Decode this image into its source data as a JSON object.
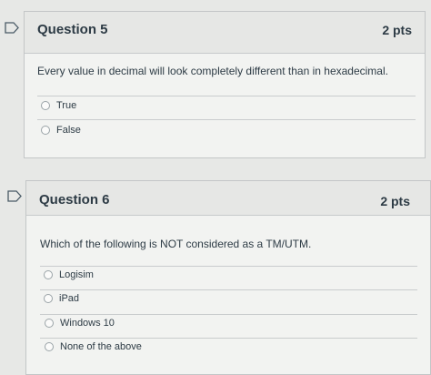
{
  "questions": [
    {
      "title": "Question 5",
      "points": "2 pts",
      "text": "Every value in decimal will look completely different than in hexadecimal.",
      "answers": [
        {
          "label": "True"
        },
        {
          "label": "False"
        }
      ]
    },
    {
      "title": "Question 6",
      "points": "2 pts",
      "text": "Which of the following is NOT considered as a TM/UTM.",
      "answers": [
        {
          "label": "Logisim"
        },
        {
          "label": "iPad"
        },
        {
          "label": "Windows 10"
        },
        {
          "label": "None of the above"
        }
      ]
    }
  ],
  "colors": {
    "page_bg": "#e7e8e6",
    "card_bg": "#f2f3f1",
    "header_bg": "#e6e7e5",
    "text": "#2d3b45",
    "flag_outline": "#4a5a66"
  },
  "icons": {
    "flag": "bookmark-flag-icon",
    "radio": "radio-button"
  }
}
